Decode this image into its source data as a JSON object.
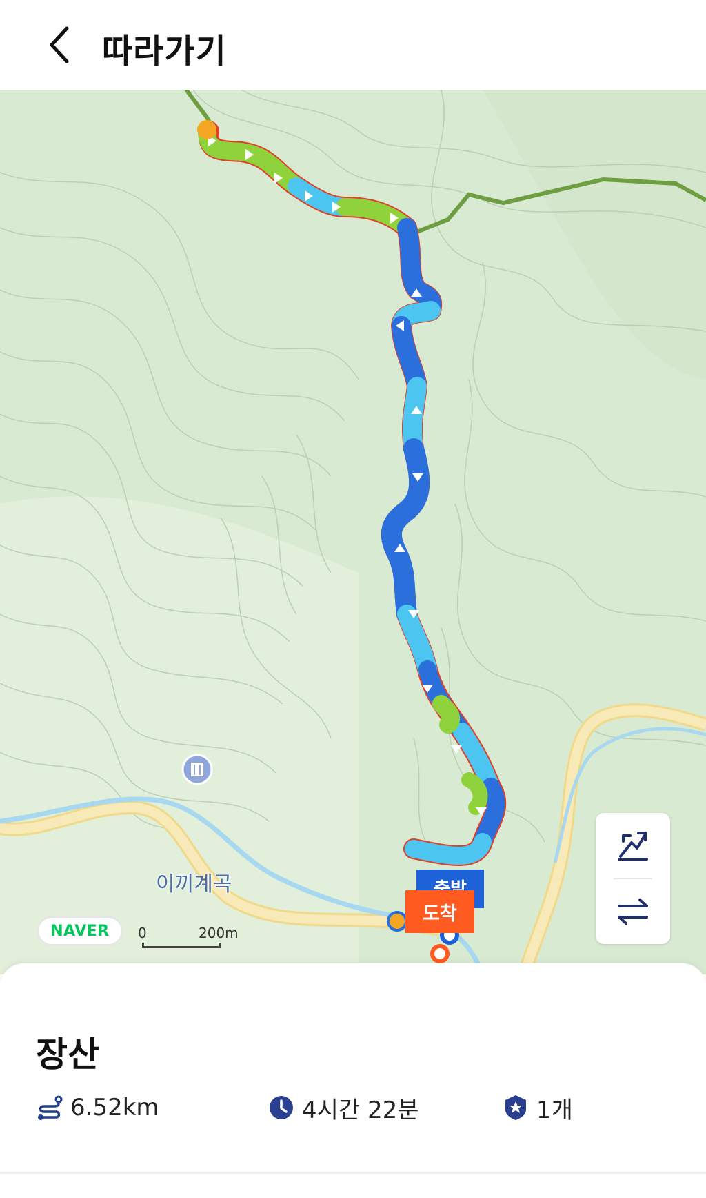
{
  "header": {
    "title": "따라가기",
    "back_icon": "chevron-left-icon"
  },
  "map": {
    "poi_label": "이끼계곡",
    "poi_icon": "waterfall-icon",
    "logo": "NAVER",
    "scale": {
      "zero": "0",
      "distance": "200m"
    },
    "start_marker": "출발",
    "end_marker": "도착",
    "controls": {
      "elevation_icon": "elevation-chart-icon",
      "reverse_icon": "swap-direction-icon"
    },
    "colors": {
      "speed_fast": "#2a6fdc",
      "speed_mid": "#4cc6f0",
      "speed_slow": "#8fd23c",
      "trail": "#6f9e42",
      "road": "#f6e3a1",
      "stream": "#9fd3ec",
      "start": "#1e62d8",
      "end": "#ff5a1f"
    }
  },
  "route": {
    "name": "장산",
    "distance": "6.52km",
    "duration": "4시간 22분",
    "badge_count": "1개",
    "distance_icon": "route-distance-icon",
    "duration_icon": "clock-icon",
    "badge_icon": "shield-star-icon"
  }
}
